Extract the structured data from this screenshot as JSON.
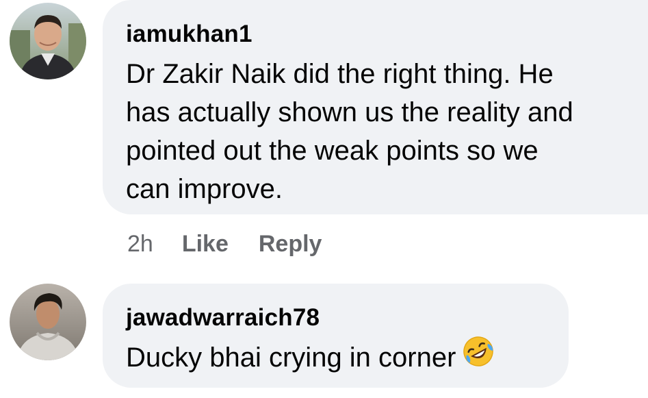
{
  "comments": [
    {
      "author": "iamukhan1",
      "text": "Dr Zakir Naik did the right thing. He has actually shown us the reality and pointed out the weak points so we can improve.",
      "lines": [
        "Dr Zakir Naik did the right thing. He",
        "has actually shown us the reality and",
        "pointed out the weak points so we",
        "can improve."
      ],
      "actions": {
        "time": "2h",
        "like": "Like",
        "reply": "Reply"
      }
    },
    {
      "author": "jawadwarraich78",
      "text": "Ducky bhai crying in corner",
      "emoji": "rolling-on-floor-laughing-emoji"
    }
  ],
  "colors": {
    "bubble_bg": "#f0f2f5",
    "text": "#050505",
    "secondary_text": "#65676b",
    "emoji_yellow": "#f7c02b",
    "emoji_tear": "#4ea8f2"
  }
}
